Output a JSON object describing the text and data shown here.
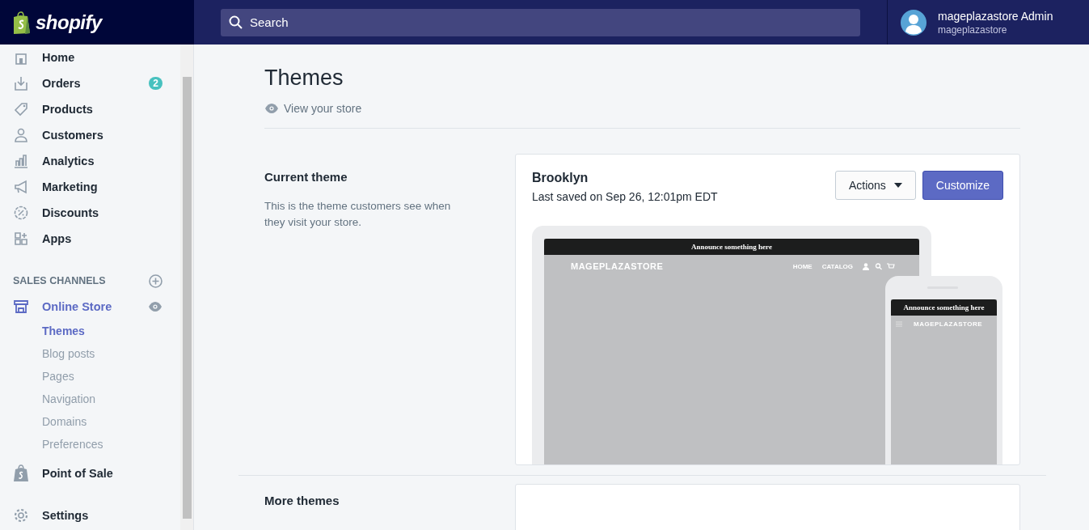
{
  "brand": {
    "name": "shopify"
  },
  "search": {
    "placeholder": "Search"
  },
  "account": {
    "name": "mageplazastore Admin",
    "store": "mageplazastore"
  },
  "nav": [
    {
      "label": "Home",
      "selected": false
    },
    {
      "label": "Orders",
      "selected": false,
      "badge": "2"
    },
    {
      "label": "Products",
      "selected": false
    },
    {
      "label": "Customers",
      "selected": false
    },
    {
      "label": "Analytics",
      "selected": false
    },
    {
      "label": "Marketing",
      "selected": false
    },
    {
      "label": "Discounts",
      "selected": false
    },
    {
      "label": "Apps",
      "selected": false
    }
  ],
  "sales_channels": {
    "heading": "SALES CHANNELS",
    "channel": {
      "label": "Online Store",
      "selected": true
    },
    "children": [
      {
        "label": "Themes",
        "selected": true
      },
      {
        "label": "Blog posts",
        "selected": false
      },
      {
        "label": "Pages",
        "selected": false
      },
      {
        "label": "Navigation",
        "selected": false
      },
      {
        "label": "Domains",
        "selected": false
      },
      {
        "label": "Preferences",
        "selected": false
      }
    ]
  },
  "bottom_nav": [
    {
      "label": "Point of Sale",
      "selected": false
    },
    {
      "label": "Settings",
      "selected": false
    }
  ],
  "page": {
    "title": "Themes",
    "view_link": "View your store"
  },
  "current_theme": {
    "heading": "Current theme",
    "description": "This is the theme customers see when they visit your store.",
    "name": "Brooklyn",
    "saved": "Last saved on Sep 26, 12:01pm EDT",
    "actions": "Actions",
    "customize": "Customize",
    "preview": {
      "announcement": "Announce something here",
      "store": "MAGEPLAZASTORE",
      "links": [
        "HOME",
        "CATALOG"
      ],
      "mobile_announcement": "Announce something here",
      "mobile_store": "MAGEPLAZASTORE"
    }
  },
  "more_themes": {
    "heading": "More themes"
  }
}
